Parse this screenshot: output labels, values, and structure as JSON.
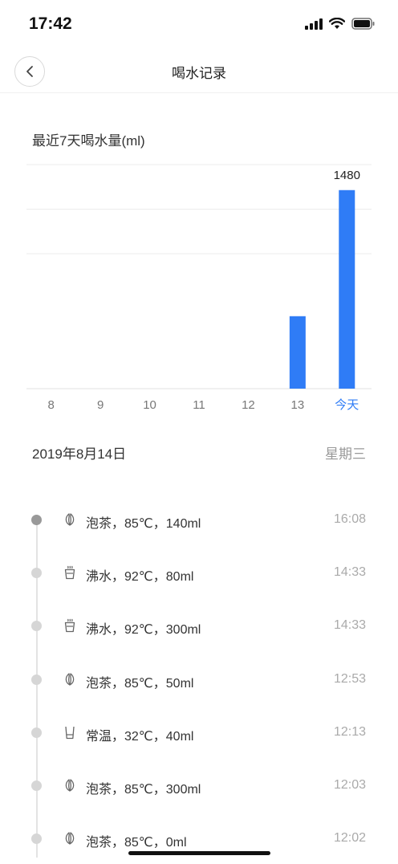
{
  "status_bar": {
    "time": "17:42"
  },
  "header": {
    "title": "喝水记录"
  },
  "chart": {
    "title": "最近7天喝水量(ml)"
  },
  "chart_data": {
    "type": "bar",
    "title": "最近7天喝水量(ml)",
    "categories": [
      "8",
      "9",
      "10",
      "11",
      "12",
      "13",
      "今天"
    ],
    "values": [
      0,
      0,
      0,
      0,
      0,
      540,
      1480
    ],
    "value_labels": [
      null,
      null,
      null,
      null,
      null,
      null,
      "1480"
    ],
    "ylim": [
      0,
      1700
    ],
    "grid": true,
    "highlight_category": "今天",
    "bar_color": "#2f7cf6",
    "highlight_color": "#2f7cf6"
  },
  "day": {
    "date": "2019年8月14日",
    "weekday": "星期三"
  },
  "records": [
    {
      "icon": "tea-leaf-icon",
      "text": "泡茶，85℃，140ml",
      "time": "16:08",
      "active": true
    },
    {
      "icon": "boiling-cup-icon",
      "text": "沸水，92℃，80ml",
      "time": "14:33",
      "active": false
    },
    {
      "icon": "boiling-cup-icon",
      "text": "沸水，92℃，300ml",
      "time": "14:33",
      "active": false
    },
    {
      "icon": "tea-leaf-icon",
      "text": "泡茶，85℃，50ml",
      "time": "12:53",
      "active": false
    },
    {
      "icon": "glass-icon",
      "text": "常温，32℃，40ml",
      "time": "12:13",
      "active": false
    },
    {
      "icon": "tea-leaf-icon",
      "text": "泡茶，85℃，300ml",
      "time": "12:03",
      "active": false
    },
    {
      "icon": "tea-leaf-icon",
      "text": "泡茶，85℃，0ml",
      "time": "12:02",
      "active": false
    }
  ],
  "colors": {
    "accent": "#2f7cf6",
    "text": "#333333",
    "muted": "#999999"
  }
}
